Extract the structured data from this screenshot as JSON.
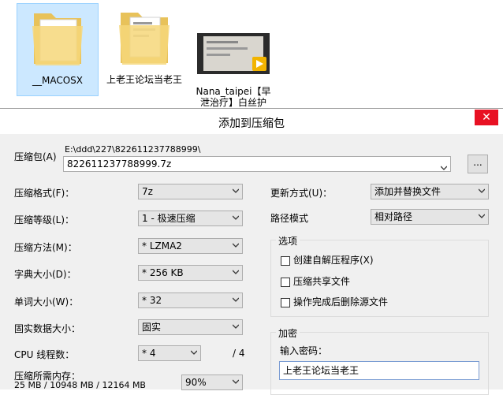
{
  "explorer": {
    "files": [
      {
        "name": "__MACOSX",
        "type": "folder",
        "icon": "folder-icon"
      },
      {
        "name": "上老王论坛当老王",
        "type": "folder",
        "icon": "folder-icon"
      },
      {
        "name": "Nana_taipei【早泄治疗】白丝护",
        "type": "video",
        "icon": "video-thumbnail",
        "badge": "Player"
      }
    ]
  },
  "dialog": {
    "title": "添加到压缩包",
    "close_glyph": "✕",
    "archive": {
      "label": "压缩包(A)",
      "path": "E:\\ddd\\227\\822611237788999\\",
      "value": "822611237788999.7z",
      "browse_label": "..."
    },
    "left": {
      "format_label": "压缩格式(F)：",
      "format_value": "7z",
      "level_label": "压缩等级(L)：",
      "level_value": "1 - 极速压缩",
      "method_label": "压缩方法(M)：",
      "method_value": "* LZMA2",
      "dict_label": "字典大小(D)：",
      "dict_value": "* 256 KB",
      "word_label": "单词大小(W)：",
      "word_value": "* 32",
      "solid_label": "固实数据大小：",
      "solid_value": "固实",
      "threads_label": "CPU 线程数：",
      "threads_value": "* 4",
      "threads_max": "/ 4",
      "mem_label": "压缩所需内存：",
      "mem_value": "25 MB / 10948 MB / 12164 MB",
      "mem_percent": "90%"
    },
    "right": {
      "update_label": "更新方式(U)：",
      "update_value": "添加并替换文件",
      "path_label": "路径模式",
      "path_value": "相对路径",
      "options_title": "选项",
      "options": [
        {
          "label": "创建自解压程序(X)",
          "checked": false
        },
        {
          "label": "压缩共享文件",
          "checked": false
        },
        {
          "label": "操作完成后删除源文件",
          "checked": false
        }
      ],
      "encrypt_title": "加密",
      "password_label": "输入密码：",
      "password_value": "上老王论坛当老王"
    }
  }
}
